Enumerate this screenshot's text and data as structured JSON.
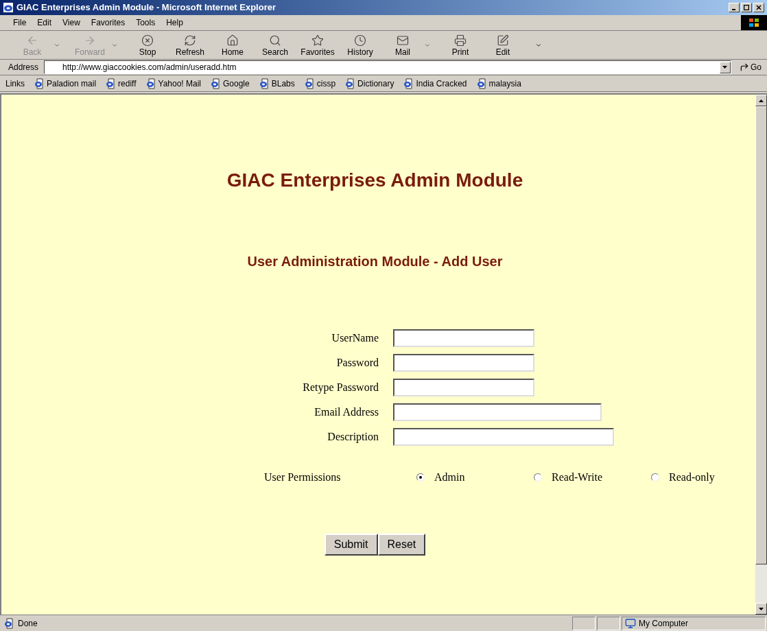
{
  "window": {
    "title": "GIAC Enterprises Admin Module - Microsoft Internet Explorer"
  },
  "menu": [
    "File",
    "Edit",
    "View",
    "Favorites",
    "Tools",
    "Help"
  ],
  "toolbar": [
    {
      "label": "Back",
      "kind": "back",
      "disabled": true,
      "dropdown": true
    },
    {
      "label": "Forward",
      "kind": "forward",
      "disabled": true,
      "dropdown": true
    },
    {
      "label": "Stop",
      "kind": "stop",
      "disabled": false,
      "dropdown": false
    },
    {
      "label": "Refresh",
      "kind": "refresh",
      "disabled": false,
      "dropdown": false
    },
    {
      "label": "Home",
      "kind": "home",
      "disabled": false,
      "dropdown": false
    },
    {
      "label": "Search",
      "kind": "search",
      "disabled": false,
      "dropdown": false
    },
    {
      "label": "Favorites",
      "kind": "favorites",
      "disabled": false,
      "dropdown": false
    },
    {
      "label": "History",
      "kind": "history",
      "disabled": false,
      "dropdown": false
    },
    {
      "label": "Mail",
      "kind": "mail",
      "disabled": false,
      "dropdown": true
    },
    {
      "label": "Print",
      "kind": "print",
      "disabled": false,
      "dropdown": false
    },
    {
      "label": "Edit",
      "kind": "edit",
      "disabled": false,
      "dropdown": false
    }
  ],
  "address": {
    "label": "Address",
    "value": "http://www.giaccookies.com/admin/useradd.htm",
    "go": "Go"
  },
  "links": {
    "label": "Links",
    "items": [
      "Paladion mail",
      "rediff",
      "Yahoo! Mail",
      "Google",
      "BLabs",
      "cissp",
      "Dictionary",
      "India Cracked",
      "malaysia"
    ]
  },
  "page": {
    "heading": "GIAC Enterprises Admin Module",
    "subheading": "User Administration Module - Add User",
    "fields": [
      {
        "label": "UserName",
        "kind": "short"
      },
      {
        "label": "Password",
        "kind": "short"
      },
      {
        "label": "Retype Password",
        "kind": "short"
      },
      {
        "label": "Email Address",
        "kind": "medium"
      },
      {
        "label": "Description",
        "kind": "long"
      }
    ],
    "permissions": {
      "label": "User Permissions",
      "options": [
        {
          "label": "Admin",
          "selected": true
        },
        {
          "label": "Read-Write",
          "selected": false
        },
        {
          "label": "Read-only",
          "selected": false
        }
      ]
    },
    "buttons": [
      "Submit",
      "Reset"
    ]
  },
  "status_bar": {
    "text": "Done",
    "zone": "My Computer"
  }
}
